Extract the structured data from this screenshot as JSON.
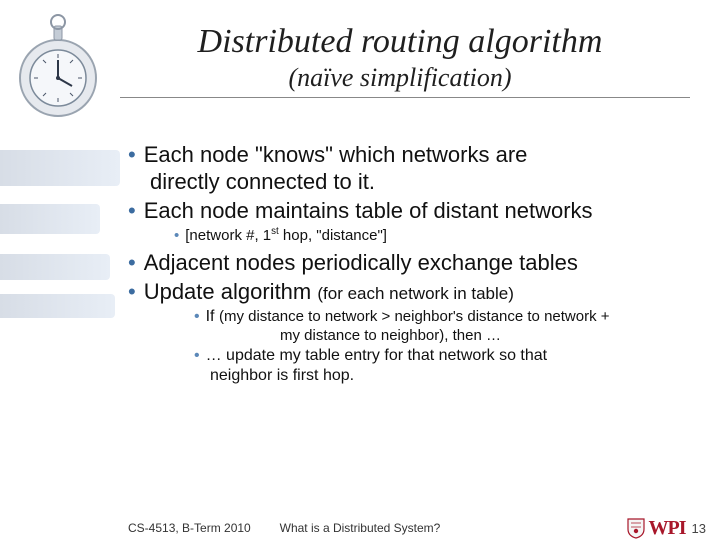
{
  "title": "Distributed routing algorithm",
  "subtitle": "(naïve simplification)",
  "bullets": {
    "b1a": "Each node \"knows\" which networks are",
    "b1b": "directly connected to it.",
    "b2": "Each node maintains table of distant networks",
    "b2s": "[network #, 1",
    "b2s_sup": "st",
    "b2s_tail": " hop, \"distance\"]",
    "b3": "Adjacent nodes periodically exchange tables",
    "b4": "Update algorithm ",
    "b4p": "(for each network in table)",
    "b4s1a": "If ",
    "b4s1b": "(my distance to network > neighbor's distance to network +",
    "b4s1c": "my distance to neighbor)",
    "b4s1d": ", then …",
    "b4s2a": "… update my table entry for that network so that",
    "b4s2b": "neighbor is first hop."
  },
  "footer": {
    "left": "CS-4513, B-Term 2010",
    "center": "What is a Distributed System?",
    "page": "13",
    "logo_text": "WPI"
  }
}
